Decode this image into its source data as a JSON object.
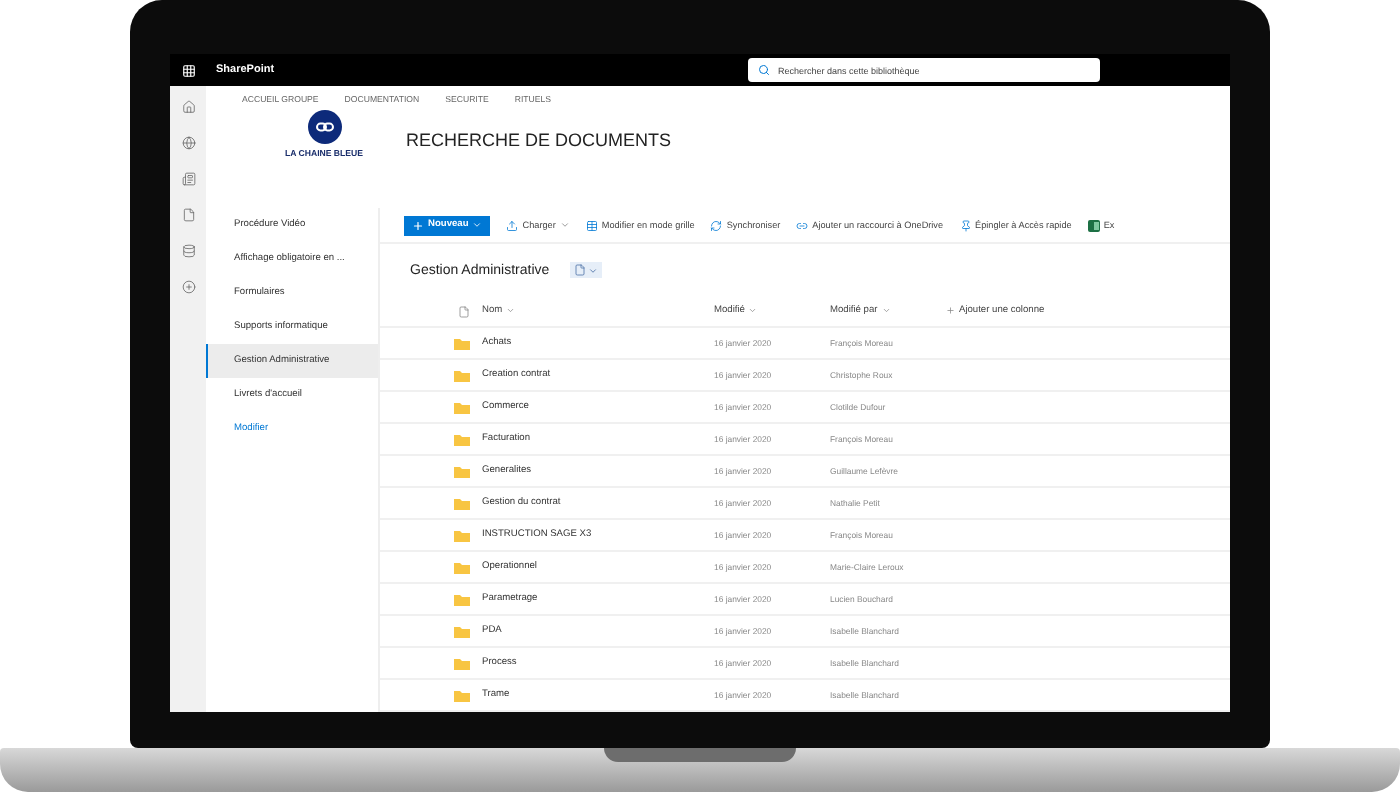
{
  "app": {
    "name": "SharePoint"
  },
  "search": {
    "placeholder": "Rechercher dans cette bibliothèque"
  },
  "site_nav": [
    "ACCUEIL GROUPE",
    "DOCUMENTATION",
    "SECURITE",
    "RITUELS"
  ],
  "site": {
    "logo_text": "LA CHAINE BLEUE",
    "title": "RECHERCHE DE DOCUMENTS"
  },
  "quick_launch": {
    "items": [
      {
        "label": "Procédure Vidéo",
        "selected": false
      },
      {
        "label": "Affichage obligatoire en ...",
        "selected": false
      },
      {
        "label": "Formulaires",
        "selected": false
      },
      {
        "label": "Supports informatique",
        "selected": false
      },
      {
        "label": "Gestion Administrative",
        "selected": true
      },
      {
        "label": "Livrets d'accueil",
        "selected": false
      }
    ],
    "edit_link": "Modifier"
  },
  "command_bar": [
    {
      "kind": "primary",
      "label": "Nouveau"
    },
    {
      "kind": "dropdown",
      "label": "Charger"
    },
    {
      "kind": "action",
      "label": "Modifier en mode grille"
    },
    {
      "kind": "action",
      "label": "Synchroniser"
    },
    {
      "kind": "action",
      "label": "Ajouter un raccourci à OneDrive"
    },
    {
      "kind": "action",
      "label": "Épingler à Accès rapide"
    },
    {
      "kind": "action",
      "label": "Ex"
    }
  ],
  "library": {
    "title": "Gestion Administrative"
  },
  "columns": [
    {
      "kind": "sort",
      "label": "Nom"
    },
    {
      "kind": "sort",
      "label": "Modifié"
    },
    {
      "kind": "sort",
      "label": "Modifié par"
    },
    {
      "kind": "add",
      "label": "Ajouter une colonne"
    }
  ],
  "rows": [
    {
      "name": "Achats",
      "modified": "16 janvier 2020",
      "modified_by": "François Moreau"
    },
    {
      "name": "Creation contrat",
      "modified": "16 janvier 2020",
      "modified_by": "Christophe Roux"
    },
    {
      "name": "Commerce",
      "modified": "16 janvier 2020",
      "modified_by": "Clotilde Dufour"
    },
    {
      "name": "Facturation",
      "modified": "16 janvier 2020",
      "modified_by": "François Moreau"
    },
    {
      "name": "Generalites",
      "modified": "16 janvier 2020",
      "modified_by": "Guillaume Lefèvre"
    },
    {
      "name": "Gestion du contrat",
      "modified": "16 janvier 2020",
      "modified_by": "Nathalie Petit"
    },
    {
      "name": "INSTRUCTION SAGE X3",
      "modified": "16 janvier 2020",
      "modified_by": "François Moreau"
    },
    {
      "name": "Operationnel",
      "modified": "16 janvier 2020",
      "modified_by": "Marie-Claire Leroux"
    },
    {
      "name": "Parametrage",
      "modified": "16 janvier 2020",
      "modified_by": "Lucien Bouchard"
    },
    {
      "name": "PDA",
      "modified": "16 janvier 2020",
      "modified_by": "Isabelle Blanchard"
    },
    {
      "name": "Process",
      "modified": "16 janvier 2020",
      "modified_by": "Isabelle Blanchard"
    },
    {
      "name": "Trame",
      "modified": "16 janvier 2020",
      "modified_by": "Isabelle Blanchard"
    }
  ]
}
